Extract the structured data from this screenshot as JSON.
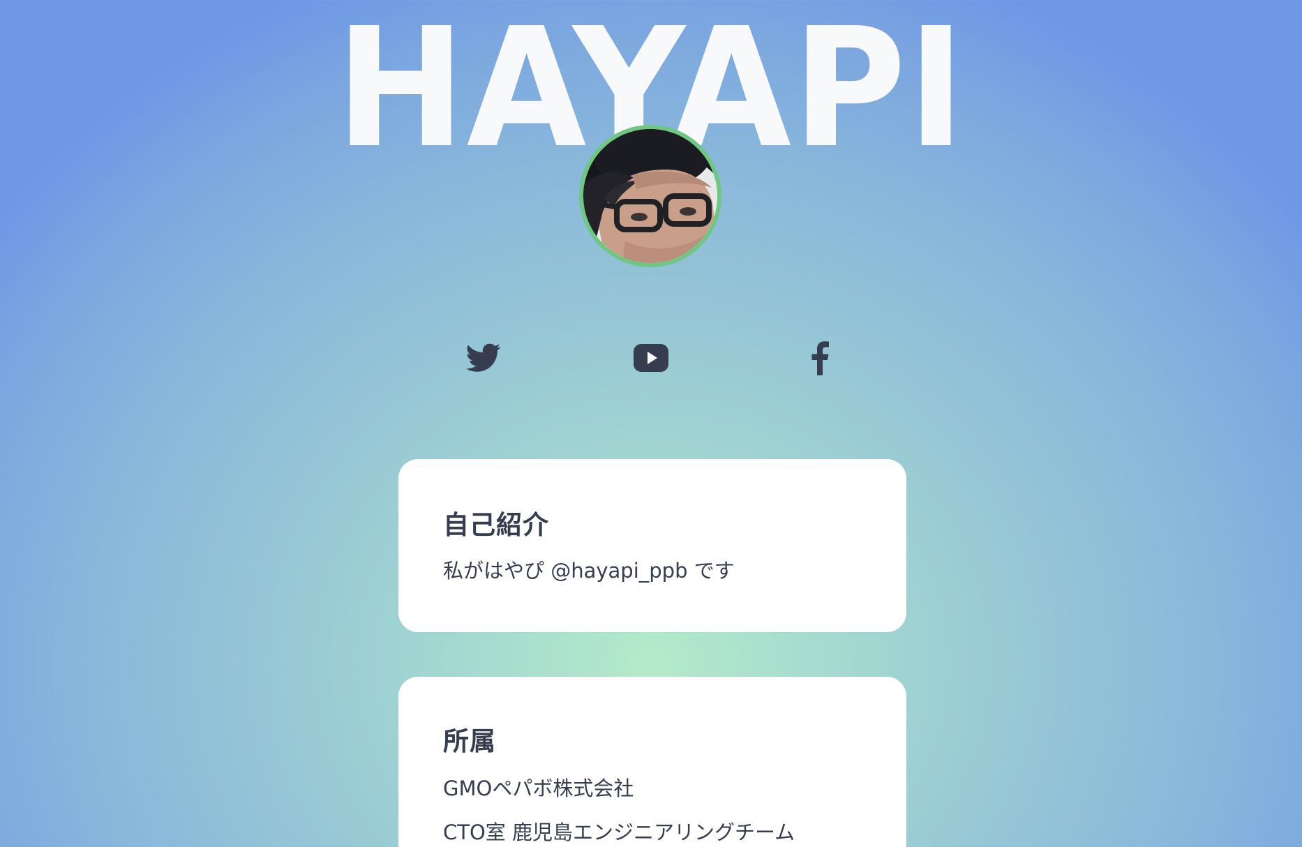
{
  "header": {
    "title": "HAYAPI"
  },
  "profile": {
    "avatar_icon": "profile-photo"
  },
  "social": {
    "links": [
      {
        "icon": "twitter-icon"
      },
      {
        "icon": "youtube-icon"
      },
      {
        "icon": "facebook-icon"
      }
    ]
  },
  "intro": {
    "heading": "自己紹介",
    "text": "私がはやぴ @hayapi_ppb です"
  },
  "affiliation": {
    "heading": "所属",
    "lines": [
      "GMOペパボ株式会社",
      "CTO室 鹿児島エンジニアリングチーム"
    ]
  },
  "colors": {
    "title": "#f7f9fb",
    "avatar_ring": "#6fc783",
    "icons": "#363d4f",
    "card_bg": "#ffffff",
    "text": "#363d4f"
  }
}
